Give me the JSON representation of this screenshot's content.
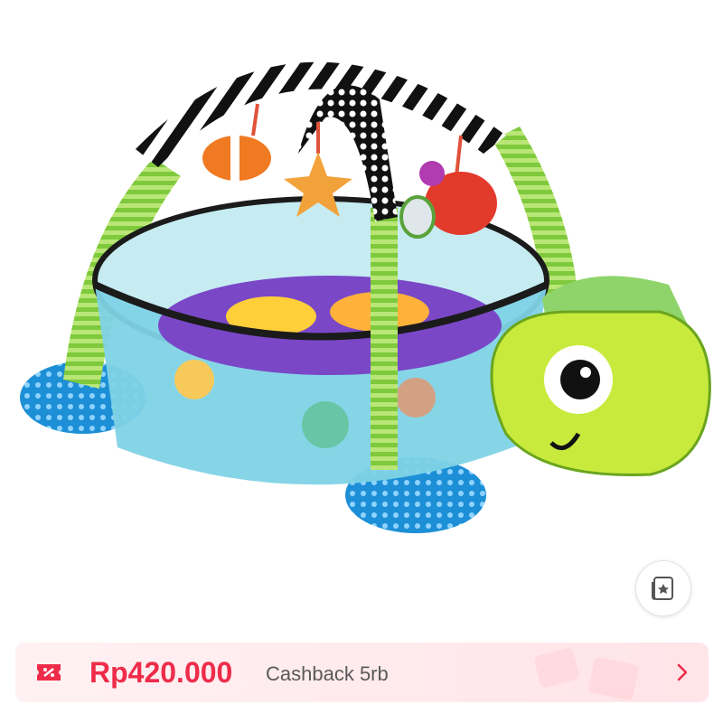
{
  "product": {
    "image_alt": "turtle activity gym ball pit play mat"
  },
  "favorite_button": {
    "icon": "card-star-icon"
  },
  "promo": {
    "icon": "voucher-icon",
    "price": "Rp420.000",
    "cashback": "Cashback 5rb",
    "chevron_icon": "chevron-right-icon",
    "accent_color": "#ee2c4a",
    "background_color": "#ffe9ec"
  }
}
